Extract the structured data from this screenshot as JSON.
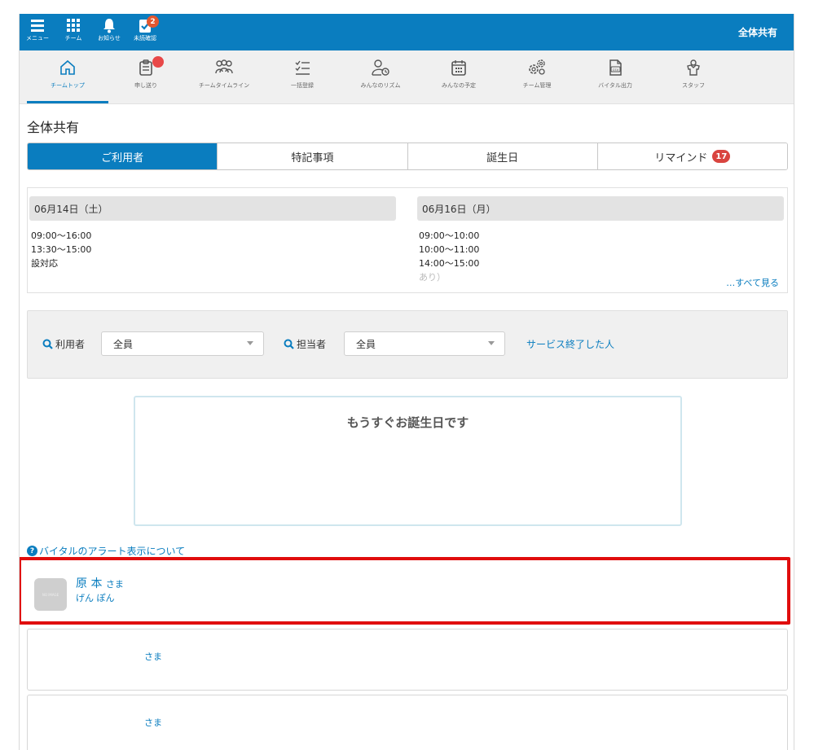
{
  "topbar": {
    "menu_label": "メニュー",
    "team_label": "チーム",
    "notice_label": "お知らせ",
    "unconfirmed_label": "未読確認",
    "unconfirmed_count": "2",
    "right_title": "全体共有",
    "accent_color": "#0a7dbf"
  },
  "nav": {
    "items": [
      {
        "label": "チームトップ",
        "icon": "home-icon"
      },
      {
        "label": "申し送り",
        "icon": "clipboard-icon"
      },
      {
        "label": "チームタイムライン",
        "icon": "people-icon"
      },
      {
        "label": "一括登録",
        "icon": "checklist-icon"
      },
      {
        "label": "みんなのリズム",
        "icon": "person-clock-icon"
      },
      {
        "label": "みんなの予定",
        "icon": "calendar-icon"
      },
      {
        "label": "チーム管理",
        "icon": "gears-icon"
      },
      {
        "label": "バイタル出力",
        "icon": "csv-file-icon"
      },
      {
        "label": "スタッフ",
        "icon": "staff-icon"
      }
    ]
  },
  "page_title": "全体共有",
  "tabs": [
    {
      "label": "ご利用者"
    },
    {
      "label": "特記事項"
    },
    {
      "label": "誕生日"
    },
    {
      "label": "リマインド",
      "badge": "17"
    }
  ],
  "schedule": {
    "left": {
      "date": "06月14日（土）",
      "lines": [
        "09:00〜16:00",
        "13:30〜15:00",
        "設対応"
      ]
    },
    "right": {
      "date": "06月16日（月）",
      "lines": [
        "09:00〜10:00",
        "10:00〜11:00",
        "14:00〜15:00",
        "あり）"
      ]
    },
    "see_all": "…すべて見る"
  },
  "filter": {
    "user_label": "利用者",
    "user_value": "全員",
    "staff_label": "担当者",
    "staff_value": "全員",
    "ended_link": "サービス終了した人"
  },
  "birthday": {
    "title": "もうすぐお誕生日です"
  },
  "vital_link": "バイタルのアラート表示について",
  "users": [
    {
      "name": "原 本",
      "suffix": "さま",
      "kana": "げん ぽん",
      "avatar_text": "NO IMAGE"
    },
    {
      "name": "",
      "suffix": "さま",
      "kana": ""
    },
    {
      "name": "",
      "suffix": "さま",
      "kana": ""
    }
  ]
}
